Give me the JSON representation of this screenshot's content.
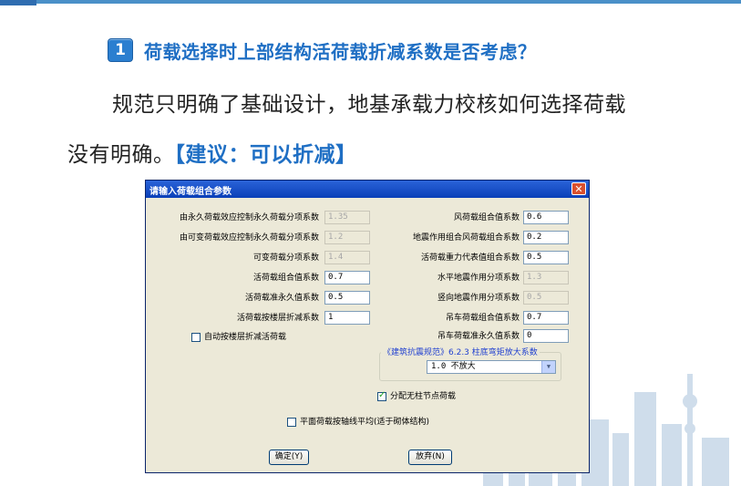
{
  "slide": {
    "badge_number": "1",
    "heading": "荷载选择时上部结构活荷载折减系数是否考虑？",
    "body_line1": "规范只明确了基础设计，地基承载力校核如何选择荷载",
    "body_line2_prefix": "没有明确。",
    "suggestion": "【建议：可以折减】",
    "accent_color": "#1f6fc4"
  },
  "dialog": {
    "title": "请输入荷载组合参数",
    "close_icon": "close-icon",
    "left_fields": [
      {
        "label": "由永久荷载效应控制永久荷载分项系数",
        "value": "1.35",
        "disabled": true
      },
      {
        "label": "由可变荷载效应控制永久荷载分项系数",
        "value": "1.2",
        "disabled": true
      },
      {
        "label": "可变荷载分项系数",
        "value": "1.4",
        "disabled": true
      },
      {
        "label": "活荷载组合值系数",
        "value": "0.7",
        "disabled": false
      },
      {
        "label": "活荷载准永久值系数",
        "value": "0.5",
        "disabled": false
      },
      {
        "label": "活荷载按楼层折减系数",
        "value": "1",
        "disabled": false
      }
    ],
    "right_fields": [
      {
        "label": "风荷载组合值系数",
        "value": "0.6",
        "disabled": false
      },
      {
        "label": "地震作用组合风荷载组合系数",
        "value": "0.2",
        "disabled": false
      },
      {
        "label": "活荷载重力代表值组合系数",
        "value": "0.5",
        "disabled": false
      },
      {
        "label": "水平地震作用分项系数",
        "value": "1.3",
        "disabled": true
      },
      {
        "label": "竖向地震作用分项系数",
        "value": "0.5",
        "disabled": true
      },
      {
        "label": "吊车荷载组合值系数",
        "value": "0.7",
        "disabled": false
      },
      {
        "label": "吊车荷载准永久值系数",
        "value": "0",
        "disabled": false
      }
    ],
    "auto_floor_reduction": {
      "label": "自动按楼层折减活荷载",
      "checked": false
    },
    "group_label": "《建筑抗震规范》6.2.3 柱底弯矩放大系数",
    "select_value": "1.0  不放大",
    "distribute_checkbox": {
      "label": "分配无柱节点荷载",
      "checked": true
    },
    "plane_checkbox": {
      "label": "平面荷载按轴线平均(适于砌体结构)",
      "checked": false
    },
    "ok_label": "确定(Y)",
    "cancel_label": "放弃(N)"
  }
}
